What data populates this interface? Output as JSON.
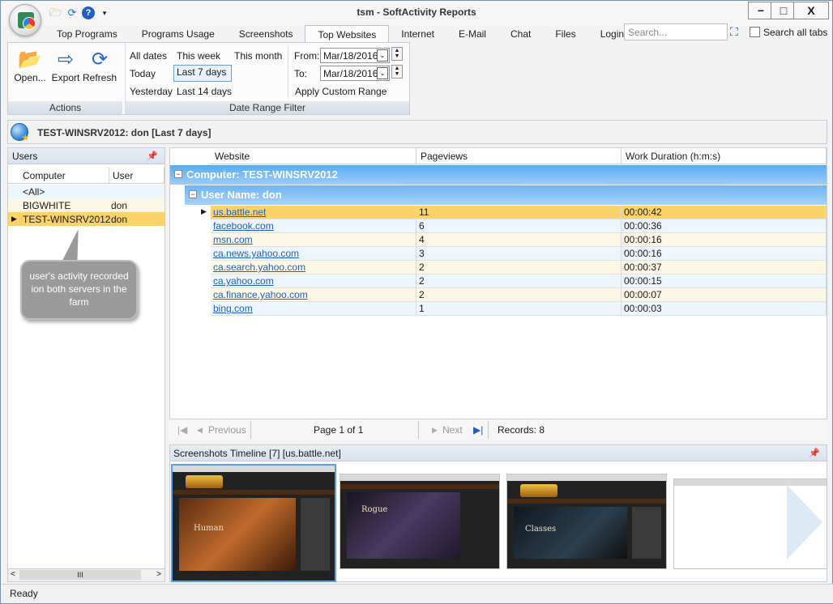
{
  "window": {
    "title": "tsm - SoftActivity Reports",
    "minimize_glyph": "−",
    "maximize_glyph": "□",
    "close_glyph": "X"
  },
  "quick_access": [
    "open-folder-icon",
    "refresh-icon",
    "help-icon",
    "customize-dropdown-icon"
  ],
  "tabs": [
    {
      "label": "Top Programs"
    },
    {
      "label": "Programs Usage"
    },
    {
      "label": "Screenshots"
    },
    {
      "label": "Top Websites",
      "active": true
    },
    {
      "label": "Internet"
    },
    {
      "label": "E-Mail"
    },
    {
      "label": "Chat"
    },
    {
      "label": "Files"
    },
    {
      "label": "Login"
    }
  ],
  "search": {
    "placeholder": "Search...",
    "search_all_label": "Search all tabs"
  },
  "ribbon": {
    "actions": {
      "group_label": "Actions",
      "open_label": "Open...",
      "export_label": "Export",
      "refresh_label": "Refresh"
    },
    "date_filter": {
      "group_label": "Date Range Filter",
      "all_dates": "All dates",
      "this_week": "This week",
      "this_month": "This month",
      "today": "Today",
      "last_7_days": "Last 7 days",
      "yesterday": "Yesterday",
      "last_14_days": "Last 14 days",
      "from_label": "From:",
      "from_value": "Mar/18/2016",
      "to_label": "To:",
      "to_value": "Mar/18/2016",
      "apply_label": "Apply Custom Range",
      "selected": "Last 7 days"
    }
  },
  "breadcrumb": {
    "text": "TEST-WINSRV2012: don [Last 7 days]"
  },
  "users_panel": {
    "title": "Users",
    "columns": [
      "Computer",
      "User"
    ],
    "rows": [
      {
        "computer": "<All>",
        "user": ""
      },
      {
        "computer": "BIGWHITE",
        "user": "don"
      },
      {
        "computer": "TEST-WINSRV2012",
        "user": "don",
        "selected": true
      }
    ],
    "scroll_thumb_glyph": "III",
    "callout": "user's activity recorded ion both servers in the farm"
  },
  "grid": {
    "columns": [
      "Website",
      "Pageviews",
      "Work Duration (h:m:s)"
    ],
    "group_computer": "Computer: TEST-WINSRV2012",
    "group_user": "User Name: don",
    "rows": [
      {
        "website": "us.battle.net",
        "pageviews": "11",
        "duration": "00:00:42",
        "selected": true
      },
      {
        "website": "facebook.com",
        "pageviews": "6",
        "duration": "00:00:36"
      },
      {
        "website": "msn.com",
        "pageviews": "4",
        "duration": "00:00:16"
      },
      {
        "website": "ca.news.yahoo.com",
        "pageviews": "3",
        "duration": "00:00:16"
      },
      {
        "website": "ca.search.yahoo.com",
        "pageviews": "2",
        "duration": "00:00:37"
      },
      {
        "website": "ca.yahoo.com",
        "pageviews": "2",
        "duration": "00:00:15"
      },
      {
        "website": "ca.finance.yahoo.com",
        "pageviews": "2",
        "duration": "00:00:07"
      },
      {
        "website": "bing.com",
        "pageviews": "1",
        "duration": "00:00:03"
      }
    ]
  },
  "pager": {
    "previous_label": "Previous",
    "page_text": "Page 1 of 1",
    "next_label": "Next",
    "records_text": "Records: 8"
  },
  "screenshots": {
    "title": "Screenshots Timeline [7] [us.battle.net]",
    "thumbnails": [
      {
        "caption": "Human"
      },
      {
        "caption": "Rogue"
      },
      {
        "caption": "Classes"
      },
      {
        "caption": ""
      }
    ]
  },
  "status": {
    "text": "Ready"
  },
  "colors": {
    "accent": "#5aaaf0",
    "selected_row": "#fbd36a",
    "alt_row": "#eef6fd",
    "link": "#1f5fbf"
  }
}
